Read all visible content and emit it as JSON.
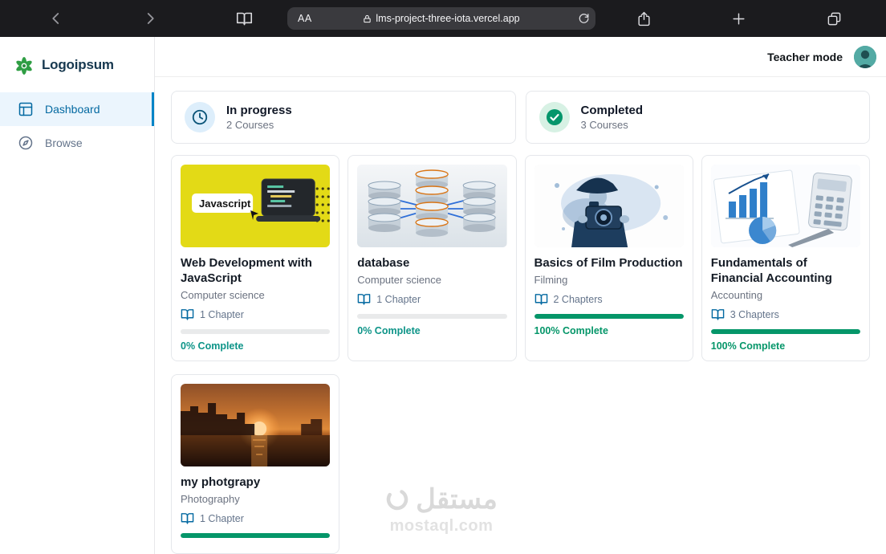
{
  "browser": {
    "reader_label": "AA",
    "url": "lms-project-three-iota.vercel.app"
  },
  "sidebar": {
    "logo": "Logoipsum",
    "items": [
      {
        "label": "Dashboard",
        "active": true
      },
      {
        "label": "Browse",
        "active": false
      }
    ]
  },
  "header": {
    "mode": "Teacher mode"
  },
  "stats": [
    {
      "icon": "clock",
      "title": "In progress",
      "count": "2 Courses"
    },
    {
      "icon": "check-circle",
      "title": "Completed",
      "count": "3 Courses"
    }
  ],
  "courses": [
    {
      "title": "Web Development with JavaScript",
      "category": "Computer science",
      "chapters": "1 Chapter",
      "progress": 0,
      "progress_label": "0% Complete",
      "image": "javascript",
      "image_label": "Javascript"
    },
    {
      "title": "database",
      "category": "Computer science",
      "chapters": "1 Chapter",
      "progress": 0,
      "progress_label": "0% Complete",
      "image": "database"
    },
    {
      "title": "Basics of Film Production",
      "category": "Filming",
      "chapters": "2 Chapters",
      "progress": 100,
      "progress_label": "100% Complete",
      "image": "film"
    },
    {
      "title": "Fundamentals of Financial Accounting",
      "category": "Accounting",
      "chapters": "3 Chapters",
      "progress": 100,
      "progress_label": "100% Complete",
      "image": "finance"
    },
    {
      "title": "my photgrapy",
      "category": "Photography",
      "chapters": "1 Chapter",
      "progress": 100,
      "progress_label": "",
      "image": "sunset"
    }
  ],
  "watermark": {
    "arabic": "مستقل",
    "domain": "mostaql.com"
  },
  "colors": {
    "accent_blue": "#0369a1",
    "success_green": "#059669",
    "progress_teal": "#0d9488",
    "chrome_dark": "#1b1b1e"
  }
}
